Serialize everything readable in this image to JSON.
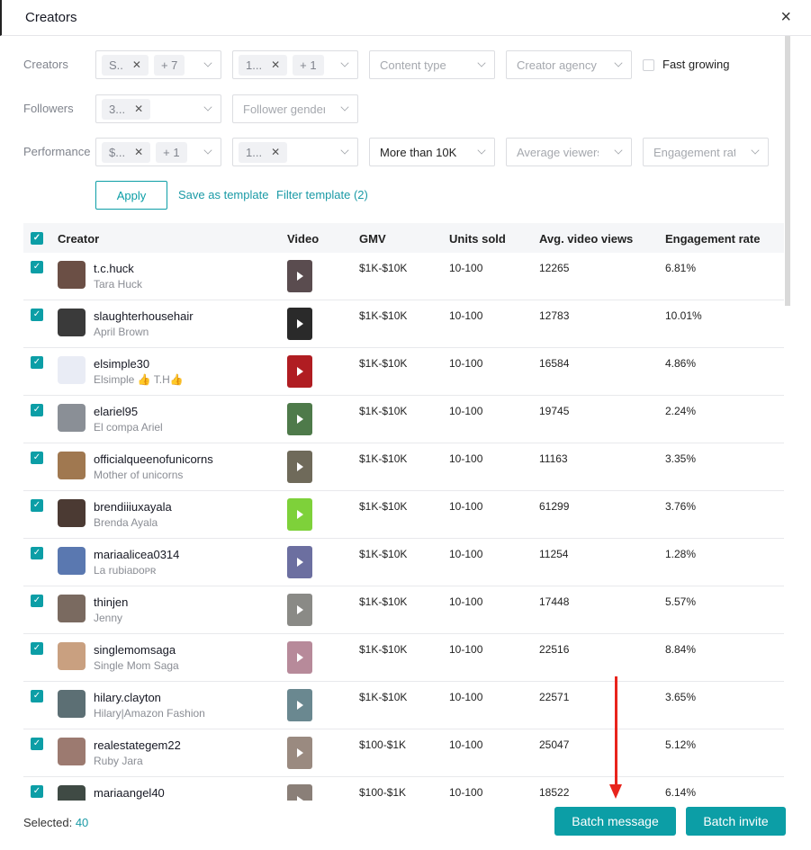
{
  "header": {
    "title": "Creators",
    "close": "×"
  },
  "filters": {
    "creators_label": "Creators",
    "followers_label": "Followers",
    "performance_label": "Performance",
    "creators_sel1": {
      "tag": "S..",
      "more": "+ 7"
    },
    "creators_sel2": {
      "tag": "1...",
      "more": "+ 1"
    },
    "content_type": "Content type",
    "creator_agency": "Creator agency",
    "fast_growing": "Fast growing",
    "followers_sel1": {
      "tag": "3..."
    },
    "follower_gender": "Follower gender",
    "perf_sel1": {
      "tag": "$...",
      "more": "+ 1"
    },
    "perf_sel2": {
      "tag": "1..."
    },
    "perf_views": "More than 10K",
    "avg_viewers": "Average viewers p",
    "engagement": "Engagement rate",
    "apply": "Apply",
    "save_template": "Save as template",
    "filter_template": "Filter template (2)"
  },
  "table": {
    "columns": [
      "Creator",
      "Video",
      "GMV",
      "Units sold",
      "Avg. video views",
      "Engagement rate"
    ],
    "rows": [
      {
        "username": "t.c.huck",
        "name": "Tara Huck",
        "gmv": "$1K-$10K",
        "units": "10-100",
        "views": "12265",
        "er": "6.81%"
      },
      {
        "username": "slaughterhousehair",
        "name": "April Brown",
        "gmv": "$1K-$10K",
        "units": "10-100",
        "views": "12783",
        "er": "10.01%"
      },
      {
        "username": "elsimple30",
        "name": "Elsimple 👍 T.H👍",
        "gmv": "$1K-$10K",
        "units": "10-100",
        "views": "16584",
        "er": "4.86%"
      },
      {
        "username": "elariel95",
        "name": "El compa Ariel",
        "gmv": "$1K-$10K",
        "units": "10-100",
        "views": "19745",
        "er": "2.24%"
      },
      {
        "username": "officialqueenofunicorns",
        "name": "Mother of unicorns",
        "gmv": "$1K-$10K",
        "units": "10-100",
        "views": "11163",
        "er": "3.35%"
      },
      {
        "username": "brendiiiuxayala",
        "name": "Brenda Ayala",
        "gmv": "$1K-$10K",
        "units": "10-100",
        "views": "61299",
        "er": "3.76%"
      },
      {
        "username": "mariaalicea0314",
        "name": "La rubiaᴅᴏᴘʀ",
        "gmv": "$1K-$10K",
        "units": "10-100",
        "views": "11254",
        "er": "1.28%"
      },
      {
        "username": "thinjen",
        "name": "Jenny",
        "gmv": "$1K-$10K",
        "units": "10-100",
        "views": "17448",
        "er": "5.57%"
      },
      {
        "username": "singlemomsaga",
        "name": "Single Mom Saga",
        "gmv": "$1K-$10K",
        "units": "10-100",
        "views": "22516",
        "er": "8.84%"
      },
      {
        "username": "hilary.clayton",
        "name": "Hilary|Amazon Fashion",
        "gmv": "$1K-$10K",
        "units": "10-100",
        "views": "22571",
        "er": "3.65%"
      },
      {
        "username": "realestategem22",
        "name": "Ruby Jara",
        "gmv": "$100-$1K",
        "units": "10-100",
        "views": "25047",
        "er": "5.12%"
      },
      {
        "username": "mariaangel40",
        "name": "",
        "gmv": "$100-$1K",
        "units": "10-100",
        "views": "18522",
        "er": "6.14%"
      }
    ]
  },
  "footer": {
    "selected_label": "Selected:",
    "selected_count": "40",
    "batch_message": "Batch message",
    "batch_invite": "Batch invite"
  },
  "colors": {
    "accent": "#0c9ea6",
    "arrow": "#e8241c"
  }
}
